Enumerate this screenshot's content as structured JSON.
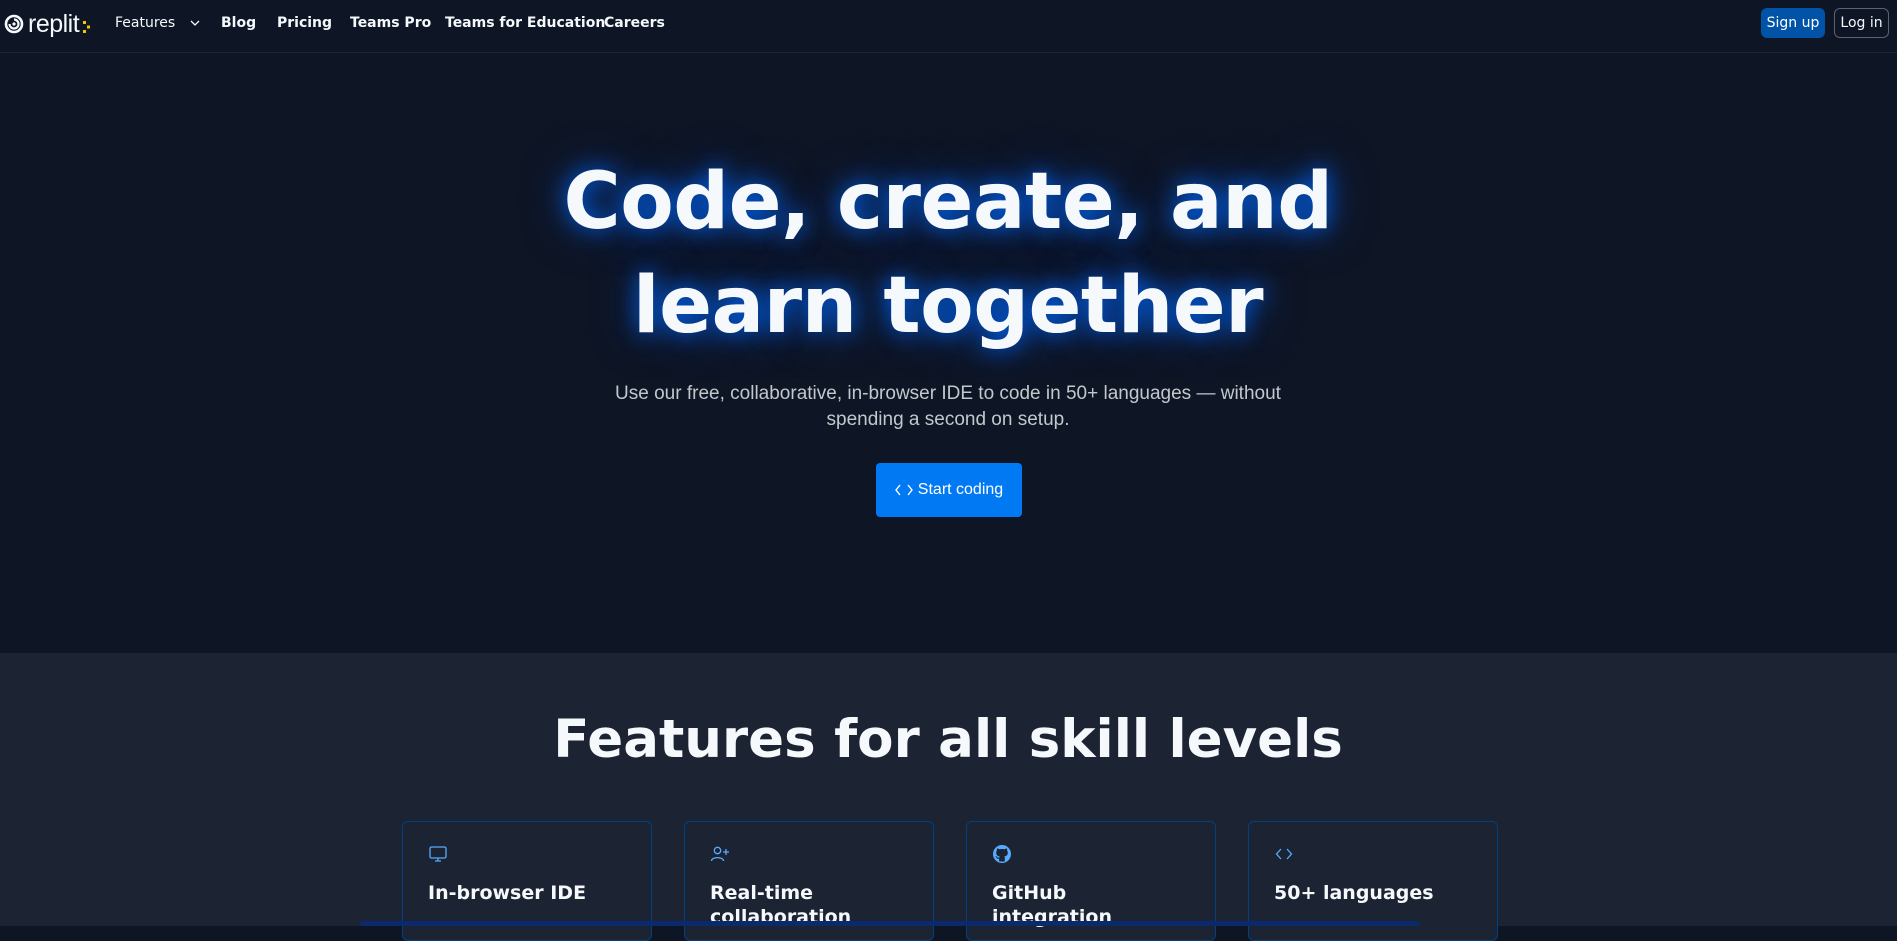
{
  "nav": {
    "logo_text": "replit",
    "links": [
      {
        "label": "Features",
        "has_dropdown": true
      },
      {
        "label": "Blog"
      },
      {
        "label": "Pricing"
      },
      {
        "label": "Teams Pro"
      },
      {
        "label": "Teams for Education"
      },
      {
        "label": "Careers"
      }
    ],
    "signup_label": "Sign up",
    "login_label": "Log in"
  },
  "hero": {
    "title_line1": "Code, create, and",
    "title_line2": "learn together",
    "subtitle_line1": "Use our free, collaborative, in-browser IDE to code in 50+ languages — without",
    "subtitle_line2": "spending a second on setup.",
    "cta_label": "Start coding",
    "cta_icon": "code-brackets-icon"
  },
  "features": {
    "title": "Features for all skill levels",
    "cards": [
      {
        "icon": "monitor-icon",
        "title": "In-browser IDE"
      },
      {
        "icon": "user-plus-icon",
        "title": "Real-time collaboration"
      },
      {
        "icon": "github-icon",
        "title": "GitHub integration"
      },
      {
        "icon": "code-brackets-icon",
        "title": "50+ languages"
      }
    ]
  },
  "colors": {
    "background": "#0e1525",
    "section_background": "#1c2333",
    "primary_button": "#0079f2",
    "signup_button": "#0053a6",
    "card_border": "#004182",
    "logo_accent": "#f5c400"
  }
}
